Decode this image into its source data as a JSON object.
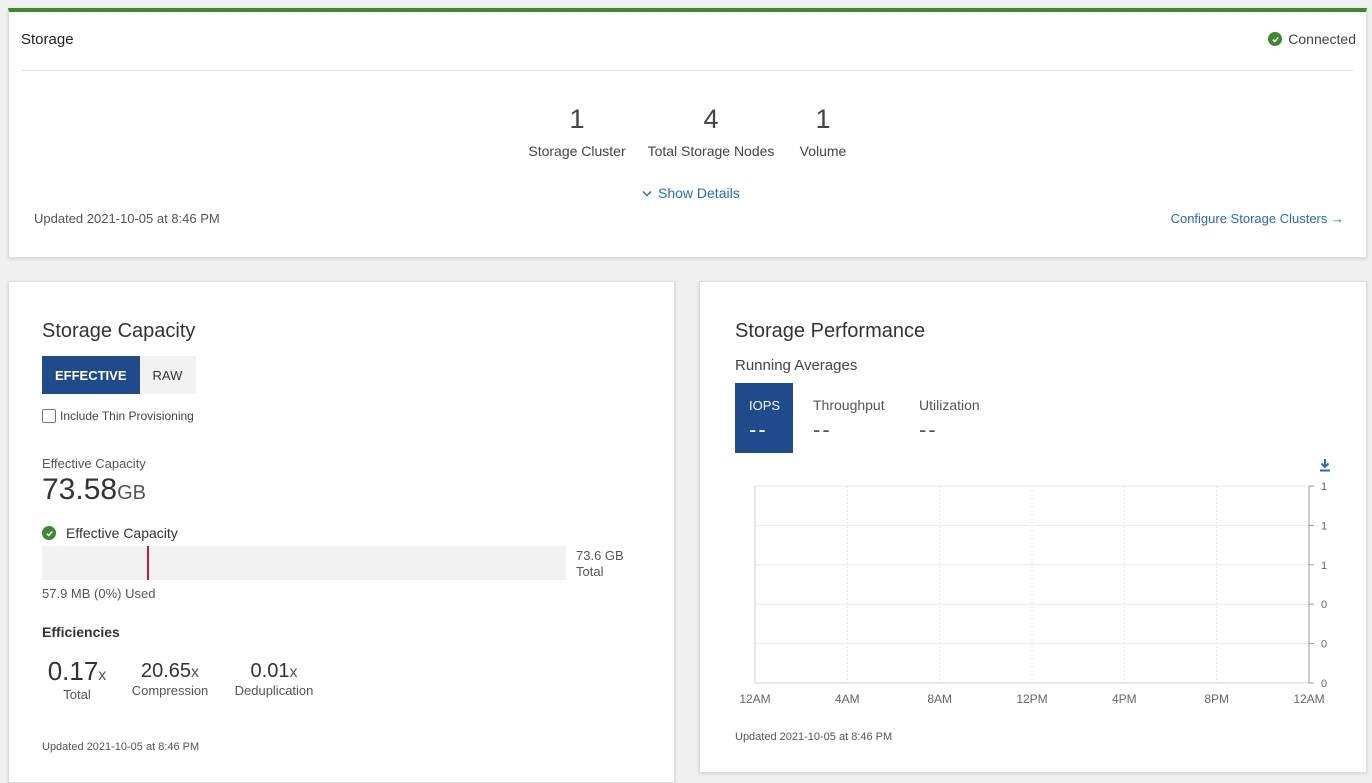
{
  "storage": {
    "title": "Storage",
    "status": "Connected",
    "stats": [
      {
        "value": "1",
        "label": "Storage Cluster"
      },
      {
        "value": "4",
        "label": "Total Storage Nodes"
      },
      {
        "value": "1",
        "label": "Volume"
      }
    ],
    "show_details": "Show Details",
    "updated": "Updated 2021-10-05 at 8:46 PM",
    "configure_link": "Configure Storage Clusters →"
  },
  "capacity": {
    "title": "Storage Capacity",
    "toggle": {
      "effective": "EFFECTIVE",
      "raw": "RAW",
      "selected": "EFFECTIVE"
    },
    "thin_provisioning_label": "Include Thin Provisioning",
    "thin_provisioning_checked": false,
    "effective_label": "Effective Capacity",
    "effective_value": "73.58",
    "effective_unit": "GB",
    "bar_heading": "Effective Capacity",
    "bar_total_value": "73.6 GB",
    "bar_total_label": "Total",
    "used_fraction": 0.2,
    "used_text": "57.9 MB (0%) Used",
    "efficiencies_heading": "Efficiencies",
    "efficiencies": [
      {
        "value": "0.17",
        "unit": "x",
        "label": "Total"
      },
      {
        "value": "20.65",
        "unit": "x",
        "label": "Compression"
      },
      {
        "value": "0.01",
        "unit": "x",
        "label": "Deduplication"
      }
    ],
    "updated": "Updated 2021-10-05 at 8:46 PM"
  },
  "performance": {
    "title": "Storage Performance",
    "subtitle": "Running Averages",
    "metrics": [
      {
        "label": "IOPS",
        "value": "--",
        "active": true
      },
      {
        "label": "Throughput",
        "value": "--",
        "active": false
      },
      {
        "label": "Utilization",
        "value": "--",
        "active": false
      }
    ],
    "updated": "Updated 2021-10-05 at 8:46 PM"
  },
  "chart_data": {
    "type": "line",
    "x_tick_labels": [
      "12AM",
      "4AM",
      "8AM",
      "12PM",
      "4PM",
      "8PM",
      "12AM"
    ],
    "y_tick_labels": [
      "1",
      "1",
      "1",
      "0",
      "0",
      "0"
    ],
    "series": [],
    "grid": true,
    "y_axis_side": "right"
  },
  "colors": {
    "accent_blue": "#1f4a8c",
    "link_blue": "#2a6ab5",
    "success_green": "#3d8b2f",
    "used_marker": "#b3203a"
  }
}
